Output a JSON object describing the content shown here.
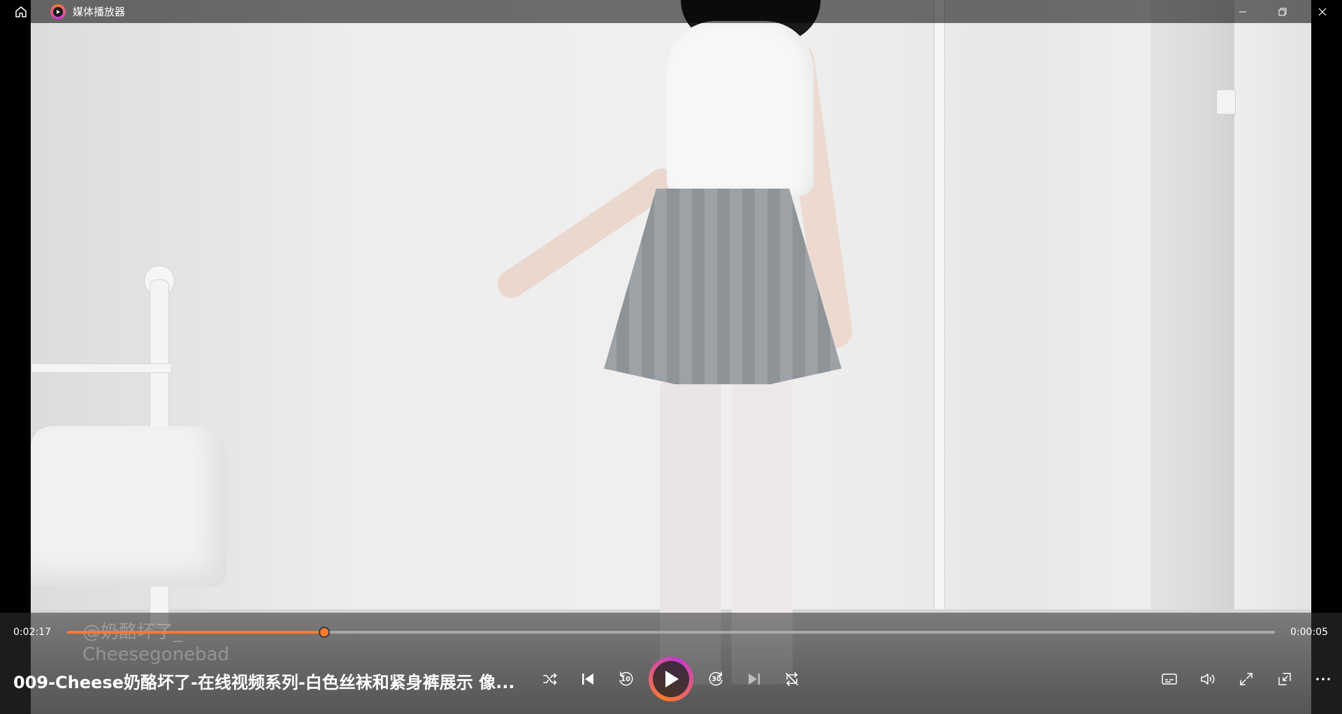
{
  "titlebar": {
    "app_title": "媒体播放器"
  },
  "video": {
    "watermark_line1": "@奶酪坏了_",
    "watermark_line2": "Cheesegonebad"
  },
  "player": {
    "current_time": "0:02:17",
    "duration": "0:00:05",
    "progress_fraction": 0.213,
    "media_title": "009-Cheese奶酪坏了-在线视频系列-白色丝袜和紧身裤展示 像...",
    "skip_back_seconds": "10",
    "skip_forward_seconds": "30"
  },
  "colors": {
    "accent": "#ff7a2f",
    "accent2": "#c33ad0"
  },
  "icons": {
    "home": "home-icon",
    "minimize": "minimize-icon",
    "restore": "restore-icon",
    "close": "close-icon",
    "shuffle": "shuffle-icon",
    "previous": "previous-icon",
    "skip_back": "skip-back-icon",
    "play": "play-icon",
    "skip_forward": "skip-forward-icon",
    "next": "next-icon",
    "repeat": "repeat-icon",
    "subtitles": "subtitles-icon",
    "volume": "volume-icon",
    "fullscreen": "fullscreen-icon",
    "mini_player": "mini-player-icon",
    "more": "more-icon"
  }
}
